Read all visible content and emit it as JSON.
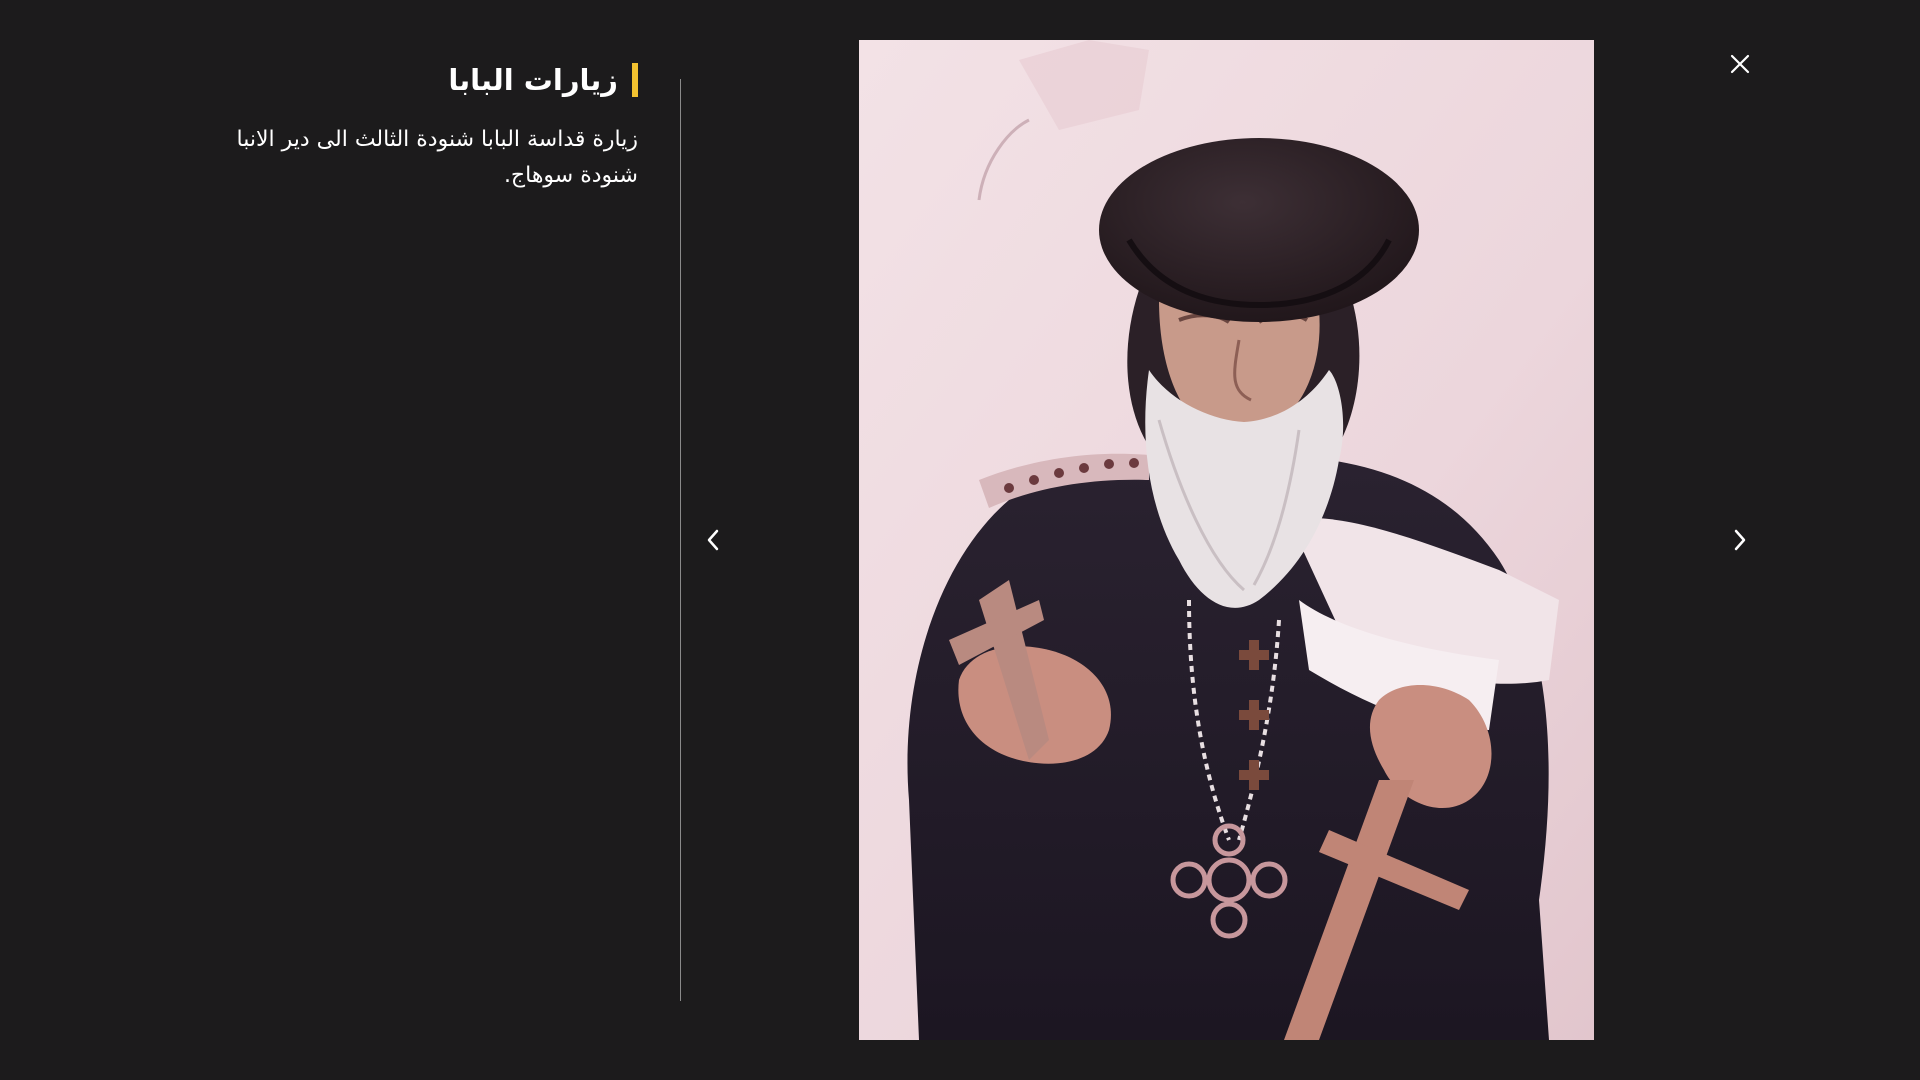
{
  "caption": {
    "title": "زيارات البابا",
    "text": "زيارة قداسة البابا شنودة الثالث الى دير الانبا شنودة سوهاج."
  },
  "controls": {
    "close_icon": "close-icon",
    "prev_icon": "chevron-left-icon",
    "next_icon": "chevron-right-icon"
  },
  "colors": {
    "background": "#1c1b1c",
    "accent": "#f2c230",
    "text": "#ffffff",
    "divider": "#8a8a8a"
  }
}
